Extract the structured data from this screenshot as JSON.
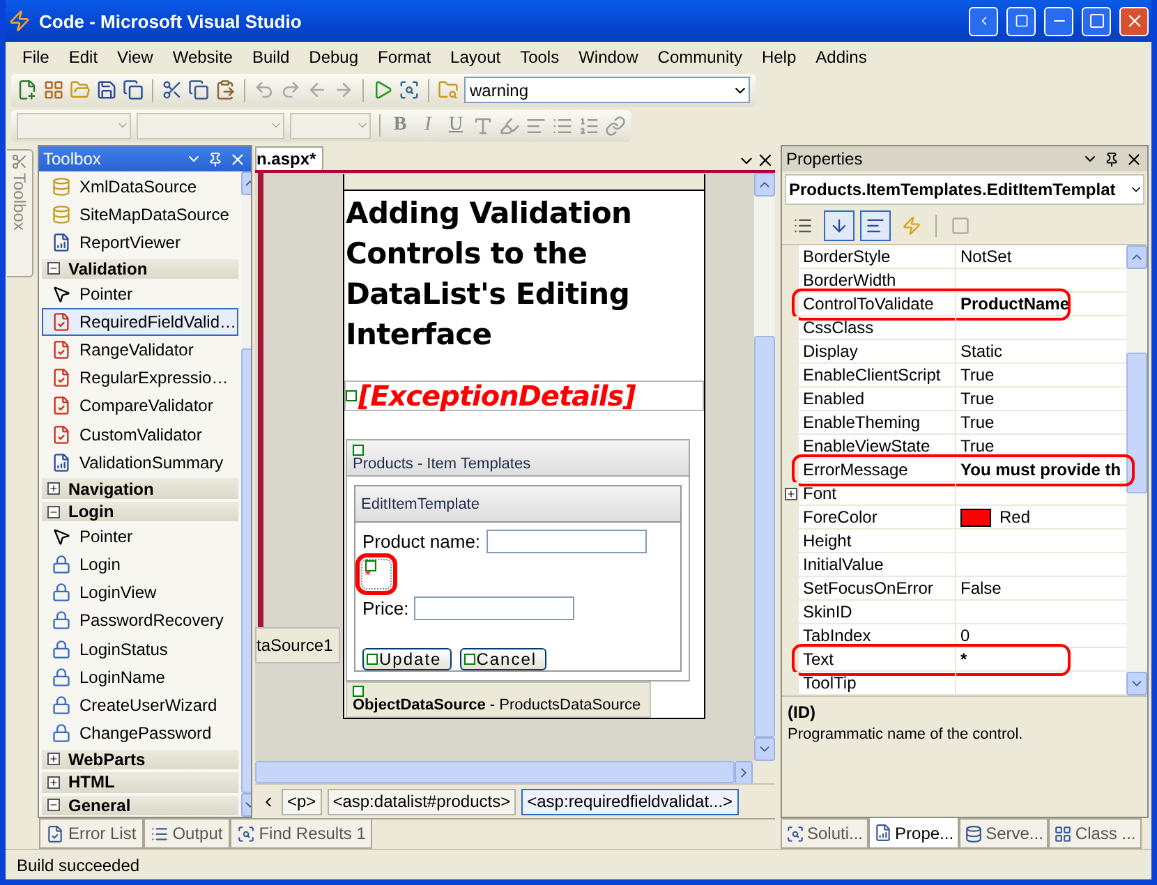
{
  "window": {
    "title": "Code - Microsoft Visual Studio"
  },
  "menu": [
    "File",
    "Edit",
    "View",
    "Website",
    "Build",
    "Debug",
    "Format",
    "Layout",
    "Tools",
    "Window",
    "Community",
    "Help",
    "Addins"
  ],
  "toolbar": {
    "buttons": [
      {
        "kind": "new",
        "disabled": false
      },
      {
        "kind": "additem",
        "disabled": false
      },
      {
        "kind": "open",
        "disabled": false
      },
      {
        "kind": "save",
        "disabled": false
      },
      {
        "kind": "saveall",
        "disabled": false
      },
      {
        "kind": "cut",
        "disabled": false
      },
      {
        "kind": "copy",
        "disabled": false
      },
      {
        "kind": "paste",
        "disabled": false
      },
      {
        "kind": "undo",
        "disabled": true
      },
      {
        "kind": "redo",
        "disabled": true
      },
      {
        "kind": "back",
        "disabled": true
      },
      {
        "kind": "forward",
        "disabled": true
      },
      {
        "kind": "run",
        "disabled": false
      },
      {
        "kind": "browse",
        "disabled": false
      },
      {
        "kind": "findfiles",
        "disabled": false
      }
    ],
    "find_value": "warning"
  },
  "format_toolbar": {
    "buttons": [
      {
        "kind": "text",
        "label": "B"
      },
      {
        "kind": "text",
        "label": "I"
      },
      {
        "kind": "text",
        "label": "U"
      },
      {
        "kind": "fontcolor"
      },
      {
        "kind": "highlight"
      },
      {
        "kind": "align"
      },
      {
        "kind": "bullets"
      },
      {
        "kind": "numbers"
      },
      {
        "kind": "link"
      }
    ]
  },
  "toolbox": {
    "title": "Toolbox",
    "side_tab": "Toolbox",
    "entries": [
      {
        "kind": "data",
        "label": "XmlDataSource",
        "selected": false
      },
      {
        "kind": "data",
        "label": "SiteMapDataSource",
        "selected": false
      },
      {
        "kind": "report",
        "label": "ReportViewer",
        "selected": false
      },
      {
        "kind": "group",
        "label": "Validation",
        "expanded": true
      },
      {
        "kind": "pointer",
        "label": "Pointer",
        "selected": false
      },
      {
        "kind": "validator",
        "label": "RequiredFieldValid…",
        "selected": true
      },
      {
        "kind": "validator",
        "label": "RangeValidator",
        "selected": false
      },
      {
        "kind": "validator",
        "label": "RegularExpressio…",
        "selected": false
      },
      {
        "kind": "validator",
        "label": "CompareValidator",
        "selected": false
      },
      {
        "kind": "validator",
        "label": "CustomValidator",
        "selected": false
      },
      {
        "kind": "report",
        "label": "ValidationSummary",
        "selected": false
      },
      {
        "kind": "group",
        "label": "Navigation",
        "expanded": false
      },
      {
        "kind": "group",
        "label": "Login",
        "expanded": true
      },
      {
        "kind": "pointer",
        "label": "Pointer",
        "selected": false
      },
      {
        "kind": "login",
        "label": "Login",
        "selected": false
      },
      {
        "kind": "login",
        "label": "LoginView",
        "selected": false
      },
      {
        "kind": "login",
        "label": "PasswordRecovery",
        "selected": false
      },
      {
        "kind": "login",
        "label": "LoginStatus",
        "selected": false
      },
      {
        "kind": "login",
        "label": "LoginName",
        "selected": false
      },
      {
        "kind": "login",
        "label": "CreateUserWizard",
        "selected": false
      },
      {
        "kind": "login",
        "label": "ChangePassword",
        "selected": false
      },
      {
        "kind": "group",
        "label": "WebParts",
        "expanded": false
      },
      {
        "kind": "group",
        "label": "HTML",
        "expanded": false
      },
      {
        "kind": "group",
        "label": "General",
        "expanded": true
      }
    ]
  },
  "designer": {
    "tab": "n.aspx*",
    "side_label": "taSource1",
    "heading": "Adding Validation Controls to the DataList's Editing Interface",
    "exception": "[ExceptionDetails]",
    "datalist": {
      "title": "Products - Item Templates",
      "template": "EditItemTemplate",
      "fields": [
        {
          "label": "Product name:",
          "validator": "*",
          "highlighted": true
        },
        {
          "label": "Price:"
        }
      ],
      "buttons": [
        "Update",
        "Cancel"
      ]
    },
    "datasource": "**ObjectDataSource** - ProductsDataSource",
    "breadcrumbs": [
      {
        "label": "<p>",
        "selected": false
      },
      {
        "label": "<asp:datalist#products>",
        "selected": false
      },
      {
        "label": "<asp:requiredfieldvalidat...>",
        "selected": true
      }
    ]
  },
  "properties": {
    "title": "Properties",
    "object": "Products.ItemTemplates.EditItemTemplat",
    "rows": [
      {
        "name": "BorderStyle",
        "value": "NotSet",
        "modified": false,
        "highlighted": false
      },
      {
        "name": "BorderWidth",
        "value": "",
        "modified": false,
        "highlighted": false
      },
      {
        "name": "ControlToValidate",
        "value": "ProductName",
        "modified": true,
        "highlighted": true
      },
      {
        "name": "CssClass",
        "value": "",
        "modified": false,
        "highlighted": false
      },
      {
        "name": "Display",
        "value": "Static",
        "modified": false,
        "highlighted": false
      },
      {
        "name": "EnableClientScript",
        "value": "True",
        "modified": false,
        "highlighted": false
      },
      {
        "name": "Enabled",
        "value": "True",
        "modified": false,
        "highlighted": false
      },
      {
        "name": "EnableTheming",
        "value": "True",
        "modified": false,
        "highlighted": false
      },
      {
        "name": "EnableViewState",
        "value": "True",
        "modified": false,
        "highlighted": false
      },
      {
        "name": "ErrorMessage",
        "value": "You must provide th",
        "modified": true,
        "highlighted": true
      },
      {
        "name": "Font",
        "value": "",
        "modified": false,
        "highlighted": false,
        "expandable": true
      },
      {
        "name": "ForeColor",
        "value": "Red",
        "modified": false,
        "highlighted": false,
        "color": "#ff0000"
      },
      {
        "name": "Height",
        "value": "",
        "modified": false,
        "highlighted": false
      },
      {
        "name": "InitialValue",
        "value": "",
        "modified": false,
        "highlighted": false
      },
      {
        "name": "SetFocusOnError",
        "value": "False",
        "modified": false,
        "highlighted": false
      },
      {
        "name": "SkinID",
        "value": "",
        "modified": false,
        "highlighted": false
      },
      {
        "name": "TabIndex",
        "value": "0",
        "modified": false,
        "highlighted": false
      },
      {
        "name": "Text",
        "value": "*",
        "modified": true,
        "highlighted": true
      },
      {
        "name": "ToolTip",
        "value": "",
        "modified": false,
        "highlighted": false
      }
    ],
    "description_title": "(ID)",
    "description": "Programmatic name of the control.",
    "tabs": [
      {
        "label": "Soluti...",
        "selected": false
      },
      {
        "label": "Prope...",
        "selected": true
      },
      {
        "label": "Serve...",
        "selected": false
      },
      {
        "label": "Class ...",
        "selected": false
      }
    ]
  },
  "bottom_tabs": [
    "Error List",
    "Output",
    "Find Results 1"
  ],
  "status": "Build succeeded"
}
